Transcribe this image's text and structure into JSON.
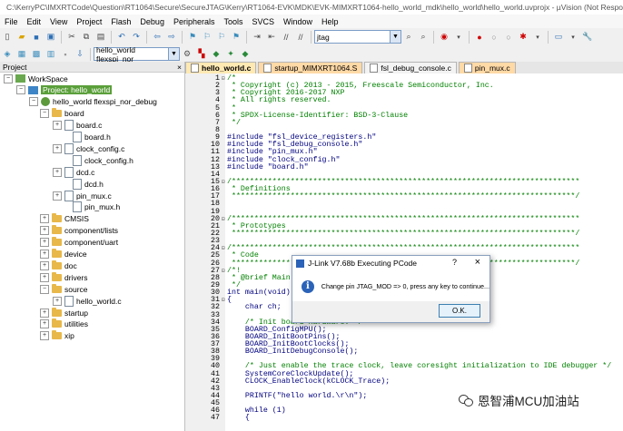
{
  "window": {
    "title": "C:\\KerryPC\\IMXRTCode\\Question\\RT1064\\Secure\\SecureJTAG\\Kerry\\RT1064-EVK\\MDK\\EVK-MIMXRT1064-hello_world_mdk\\hello_world\\hello_world.uvprojx - µVision  (Not Responding)"
  },
  "menu": [
    "File",
    "Edit",
    "View",
    "Project",
    "Flash",
    "Debug",
    "Peripherals",
    "Tools",
    "SVCS",
    "Window",
    "Help"
  ],
  "toolbar": {
    "search_value": "jtag",
    "target_value": "hello_world flexspi_nor_"
  },
  "project_panel": {
    "title": "Project",
    "close": "×",
    "tree": [
      {
        "label": "WorkSpace",
        "toggle": "−",
        "type": "workspace"
      },
      {
        "label": "Project: hello_world",
        "toggle": "−",
        "type": "project"
      },
      {
        "label": "hello_world flexspi_nor_debug",
        "toggle": "−",
        "type": "target"
      },
      {
        "label": "board",
        "toggle": "−",
        "type": "folder"
      },
      {
        "label": "board.c",
        "toggle": "+",
        "type": "file"
      },
      {
        "label": "board.h",
        "toggle": "",
        "type": "file"
      },
      {
        "label": "clock_config.c",
        "toggle": "+",
        "type": "file"
      },
      {
        "label": "clock_config.h",
        "toggle": "",
        "type": "file"
      },
      {
        "label": "dcd.c",
        "toggle": "+",
        "type": "file"
      },
      {
        "label": "dcd.h",
        "toggle": "",
        "type": "file"
      },
      {
        "label": "pin_mux.c",
        "toggle": "+",
        "type": "file"
      },
      {
        "label": "pin_mux.h",
        "toggle": "",
        "type": "file"
      },
      {
        "label": "CMSIS",
        "toggle": "+",
        "type": "folder"
      },
      {
        "label": "component/lists",
        "toggle": "+",
        "type": "folder"
      },
      {
        "label": "component/uart",
        "toggle": "+",
        "type": "folder"
      },
      {
        "label": "device",
        "toggle": "+",
        "type": "folder"
      },
      {
        "label": "doc",
        "toggle": "+",
        "type": "folder"
      },
      {
        "label": "drivers",
        "toggle": "+",
        "type": "folder"
      },
      {
        "label": "source",
        "toggle": "−",
        "type": "folder"
      },
      {
        "label": "hello_world.c",
        "toggle": "+",
        "type": "file"
      },
      {
        "label": "startup",
        "toggle": "+",
        "type": "folder"
      },
      {
        "label": "utilities",
        "toggle": "+",
        "type": "folder"
      },
      {
        "label": "xip",
        "toggle": "+",
        "type": "folder"
      }
    ]
  },
  "tabs": [
    {
      "label": "hello_world.c",
      "active": true
    },
    {
      "label": "startup_MIMXRT1064.S",
      "active": false
    },
    {
      "label": "fsl_debug_console.c",
      "active": false
    },
    {
      "label": "pin_mux.c",
      "active": false
    }
  ],
  "code": [
    {
      "n": "1",
      "fold": "−",
      "cls": "c-cmt",
      "t": "/*"
    },
    {
      "n": "2",
      "fold": "",
      "cls": "c-cmt",
      "t": " * Copyright (c) 2013 - 2015, Freescale Semiconductor, Inc."
    },
    {
      "n": "3",
      "fold": "",
      "cls": "c-cmt",
      "t": " * Copyright 2016-2017 NXP"
    },
    {
      "n": "4",
      "fold": "",
      "cls": "c-cmt",
      "t": " * All rights reserved."
    },
    {
      "n": "5",
      "fold": "",
      "cls": "c-cmt",
      "t": " *"
    },
    {
      "n": "6",
      "fold": "",
      "cls": "c-cmt",
      "t": " * SPDX-License-Identifier: BSD-3-Clause"
    },
    {
      "n": "7",
      "fold": "",
      "cls": "c-cmt",
      "t": " */"
    },
    {
      "n": "8",
      "fold": "",
      "cls": "c-plain",
      "t": ""
    },
    {
      "n": "9",
      "fold": "",
      "cls": "c-pre",
      "t": "#include \"fsl_device_registers.h\""
    },
    {
      "n": "10",
      "fold": "",
      "cls": "c-pre",
      "t": "#include \"fsl_debug_console.h\""
    },
    {
      "n": "11",
      "fold": "",
      "cls": "c-pre",
      "t": "#include \"pin_mux.h\""
    },
    {
      "n": "12",
      "fold": "",
      "cls": "c-pre",
      "t": "#include \"clock_config.h\""
    },
    {
      "n": "13",
      "fold": "",
      "cls": "c-pre",
      "t": "#include \"board.h\""
    },
    {
      "n": "14",
      "fold": "",
      "cls": "c-plain",
      "t": ""
    },
    {
      "n": "15",
      "fold": "−",
      "cls": "c-cmt",
      "t": "/*****************************************************************************"
    },
    {
      "n": "16",
      "fold": "",
      "cls": "c-cmt",
      "t": " * Definitions"
    },
    {
      "n": "17",
      "fold": "",
      "cls": "c-cmt",
      "t": " ****************************************************************************/"
    },
    {
      "n": "18",
      "fold": "",
      "cls": "c-plain",
      "t": ""
    },
    {
      "n": "19",
      "fold": "",
      "cls": "c-plain",
      "t": ""
    },
    {
      "n": "20",
      "fold": "−",
      "cls": "c-cmt",
      "t": "/*****************************************************************************"
    },
    {
      "n": "21",
      "fold": "",
      "cls": "c-cmt",
      "t": " * Prototypes"
    },
    {
      "n": "22",
      "fold": "",
      "cls": "c-cmt",
      "t": " ****************************************************************************/"
    },
    {
      "n": "23",
      "fold": "",
      "cls": "c-plain",
      "t": ""
    },
    {
      "n": "24",
      "fold": "−",
      "cls": "c-cmt",
      "t": "/*****************************************************************************"
    },
    {
      "n": "25",
      "fold": "",
      "cls": "c-cmt",
      "t": " * Code"
    },
    {
      "n": "26",
      "fold": "",
      "cls": "c-cmt",
      "t": " ****************************************************************************/"
    },
    {
      "n": "27",
      "fold": "−",
      "cls": "c-cmt",
      "t": "/*!"
    },
    {
      "n": "28",
      "fold": "",
      "cls": "c-cmt",
      "t": " * @brief Main function"
    },
    {
      "n": "29",
      "fold": "",
      "cls": "c-cmt",
      "t": " */"
    },
    {
      "n": "30",
      "fold": "",
      "cls": "c-plain",
      "t": "int main(void)"
    },
    {
      "n": "31",
      "fold": "−",
      "cls": "c-plain",
      "t": "{"
    },
    {
      "n": "32",
      "fold": "",
      "cls": "c-plain",
      "t": "    char ch;"
    },
    {
      "n": "33",
      "fold": "",
      "cls": "c-plain",
      "t": ""
    },
    {
      "n": "34",
      "fold": "",
      "cls": "c-cmt",
      "t": "    /* Init board hardware. */"
    },
    {
      "n": "35",
      "fold": "",
      "cls": "c-plain",
      "t": "    BOARD_ConfigMPU();"
    },
    {
      "n": "36",
      "fold": "",
      "cls": "c-plain",
      "t": "    BOARD_InitBootPins();"
    },
    {
      "n": "37",
      "fold": "",
      "cls": "c-plain",
      "t": "    BOARD_InitBootClocks();"
    },
    {
      "n": "38",
      "fold": "",
      "cls": "c-plain",
      "t": "    BOARD_InitDebugConsole();"
    },
    {
      "n": "39",
      "fold": "",
      "cls": "c-plain",
      "t": ""
    },
    {
      "n": "40",
      "fold": "",
      "cls": "c-cmt",
      "t": "    /* Just enable the trace clock, leave coresight initialization to IDE debugger */"
    },
    {
      "n": "41",
      "fold": "",
      "cls": "c-plain",
      "t": "    SystemCoreClockUpdate();"
    },
    {
      "n": "42",
      "fold": "",
      "cls": "c-plain",
      "t": "    CLOCK_EnableClock(kCLOCK_Trace);"
    },
    {
      "n": "43",
      "fold": "",
      "cls": "c-plain",
      "t": ""
    },
    {
      "n": "44",
      "fold": "",
      "cls": "c-plain",
      "t": "    PRINTF(\"hello world.\\r\\n\");"
    },
    {
      "n": "45",
      "fold": "",
      "cls": "c-plain",
      "t": ""
    },
    {
      "n": "46",
      "fold": "",
      "cls": "c-plain",
      "t": "    while (1)"
    },
    {
      "n": "47",
      "fold": "",
      "cls": "c-plain",
      "t": "    {"
    }
  ],
  "dialog": {
    "title": "J-Link V7.68b Executing PCode",
    "help": "?",
    "close": "×",
    "message": "Change pin JTAG_MOD => 0, press any key to continue...",
    "ok": "O.K."
  },
  "watermark": {
    "text": "恩智浦MCU加油站"
  }
}
